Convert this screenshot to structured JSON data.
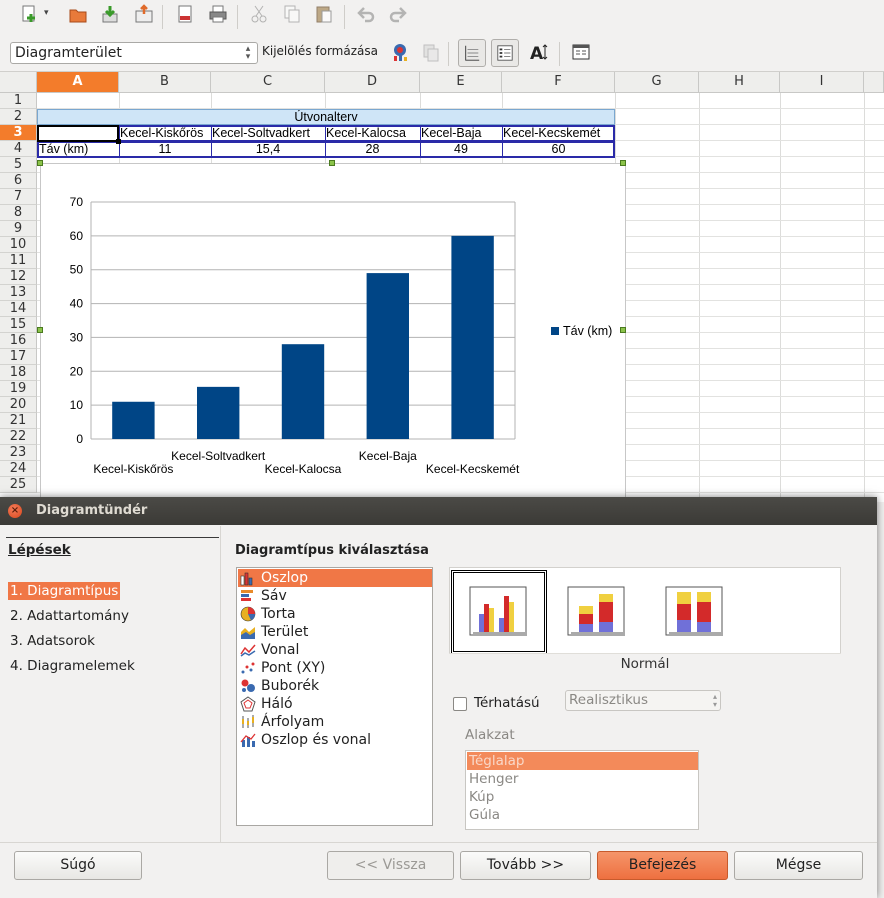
{
  "toolbar": {
    "name_box": "Diagramterület",
    "format_selection": "Kijelölés formázása"
  },
  "sheet": {
    "columns": [
      "A",
      "B",
      "C",
      "D",
      "E",
      "F",
      "G",
      "H",
      "I"
    ],
    "rows": [
      "1",
      "2",
      "3",
      "4",
      "5",
      "6",
      "7",
      "8",
      "9",
      "10",
      "11",
      "12",
      "13",
      "14",
      "15",
      "16",
      "17",
      "18",
      "19",
      "20",
      "21",
      "22",
      "23",
      "24",
      "25"
    ],
    "table_title": "Útvonalterv",
    "headers": [
      "",
      "Kecel-Kiskőrös",
      "Kecel-Soltvadkert",
      "Kecel-Kalocsa",
      "Kecel-Baja",
      "Kecel-Kecskemét"
    ],
    "row_label": "Táv (km)",
    "values": [
      "11",
      "15,4",
      "28",
      "49",
      "60"
    ]
  },
  "chart_data": {
    "type": "bar",
    "categories": [
      "Kecel-Kiskőrös",
      "Kecel-Soltvadkert",
      "Kecel-Kalocsa",
      "Kecel-Baja",
      "Kecel-Kecskemét"
    ],
    "series": [
      {
        "name": "Táv (km)",
        "values": [
          11,
          15.4,
          28,
          49,
          60
        ],
        "color": "#004586"
      }
    ],
    "ylim": [
      0,
      70
    ],
    "yticks": [
      "0",
      "10",
      "20",
      "30",
      "40",
      "50",
      "60",
      "70"
    ],
    "grid": true,
    "legend": "right"
  },
  "dialog": {
    "title": "Diagramtündér",
    "steps_title": "Lépések",
    "steps": [
      "1. Diagramtípus",
      "2. Adattartomány",
      "3. Adatsorok",
      "4. Diagramelemek"
    ],
    "section_title": "Diagramtípus kiválasztása",
    "chart_types": [
      "Oszlop",
      "Sáv",
      "Torta",
      "Terület",
      "Vonal",
      "Pont (XY)",
      "Buborék",
      "Háló",
      "Árfolyam",
      "Oszlop és vonal"
    ],
    "variant_label": "Normál",
    "threed_label": "Térhatású",
    "threed_combo": "Realisztikus",
    "shape_label": "Alakzat",
    "shapes": [
      "Téglalap",
      "Henger",
      "Kúp",
      "Gúla"
    ],
    "buttons": {
      "help": "Súgó",
      "back": "<< Vissza",
      "next": "Tovább >>",
      "finish": "Befejezés",
      "cancel": "Mégse"
    }
  }
}
